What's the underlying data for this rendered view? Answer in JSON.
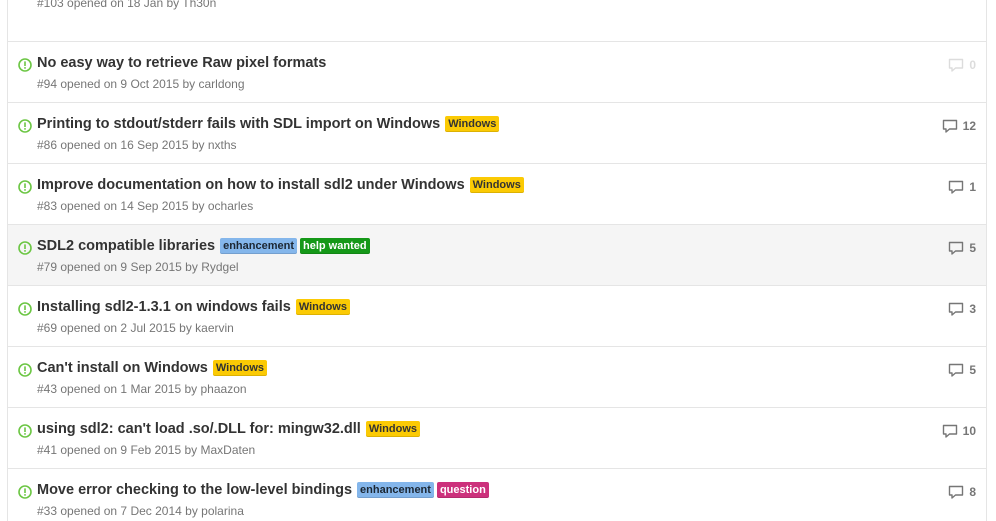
{
  "partial_top_meta": "#103 opened on 18 Jan by Th30n",
  "issues": [
    {
      "title": "No easy way to retrieve Raw pixel formats",
      "labels": [],
      "number": "#94",
      "opened_text": "opened on 9 Oct 2015 by",
      "author": "carldong",
      "comments": "0",
      "faded_comments": true
    },
    {
      "title": "Printing to stdout/stderr fails with SDL import on Windows",
      "labels": [
        {
          "text": "Windows",
          "kind": "windows"
        }
      ],
      "number": "#86",
      "opened_text": "opened on 16 Sep 2015 by",
      "author": "nxths",
      "comments": "12"
    },
    {
      "title": "Improve documentation on how to install sdl2 under Windows",
      "labels": [
        {
          "text": "Windows",
          "kind": "windows"
        }
      ],
      "number": "#83",
      "opened_text": "opened on 14 Sep 2015 by",
      "author": "ocharles",
      "comments": "1"
    },
    {
      "title": "SDL2 compatible libraries",
      "labels": [
        {
          "text": "enhancement",
          "kind": "enhancement"
        },
        {
          "text": "help wanted",
          "kind": "help"
        }
      ],
      "number": "#79",
      "opened_text": "opened on 9 Sep 2015 by",
      "author": "Rydgel",
      "comments": "5",
      "highlighted": true
    },
    {
      "title": "Installing sdl2-1.3.1 on windows fails",
      "labels": [
        {
          "text": "Windows",
          "kind": "windows"
        }
      ],
      "number": "#69",
      "opened_text": "opened on 2 Jul 2015 by",
      "author": "kaervin",
      "comments": "3"
    },
    {
      "title": "Can't install on Windows",
      "labels": [
        {
          "text": "Windows",
          "kind": "windows"
        }
      ],
      "number": "#43",
      "opened_text": "opened on 1 Mar 2015 by",
      "author": "phaazon",
      "comments": "5"
    },
    {
      "title": "using sdl2: can't load .so/.DLL for: mingw32.dll",
      "labels": [
        {
          "text": "Windows",
          "kind": "windows"
        }
      ],
      "number": "#41",
      "opened_text": "opened on 9 Feb 2015 by",
      "author": "MaxDaten",
      "comments": "10"
    },
    {
      "title": "Move error checking to the low-level bindings",
      "labels": [
        {
          "text": "enhancement",
          "kind": "enhancement"
        },
        {
          "text": "question",
          "kind": "question"
        }
      ],
      "number": "#33",
      "opened_text": "opened on 7 Dec 2014 by",
      "author": "polarina",
      "comments": "8"
    }
  ],
  "colors": {
    "open_icon": "#6cc644",
    "windows": "#fbca04",
    "enhancement": "#84b6eb",
    "help": "#159818",
    "question": "#cc317c"
  },
  "icons": {
    "state": "issue-opened-icon",
    "comments": "comment-icon"
  }
}
